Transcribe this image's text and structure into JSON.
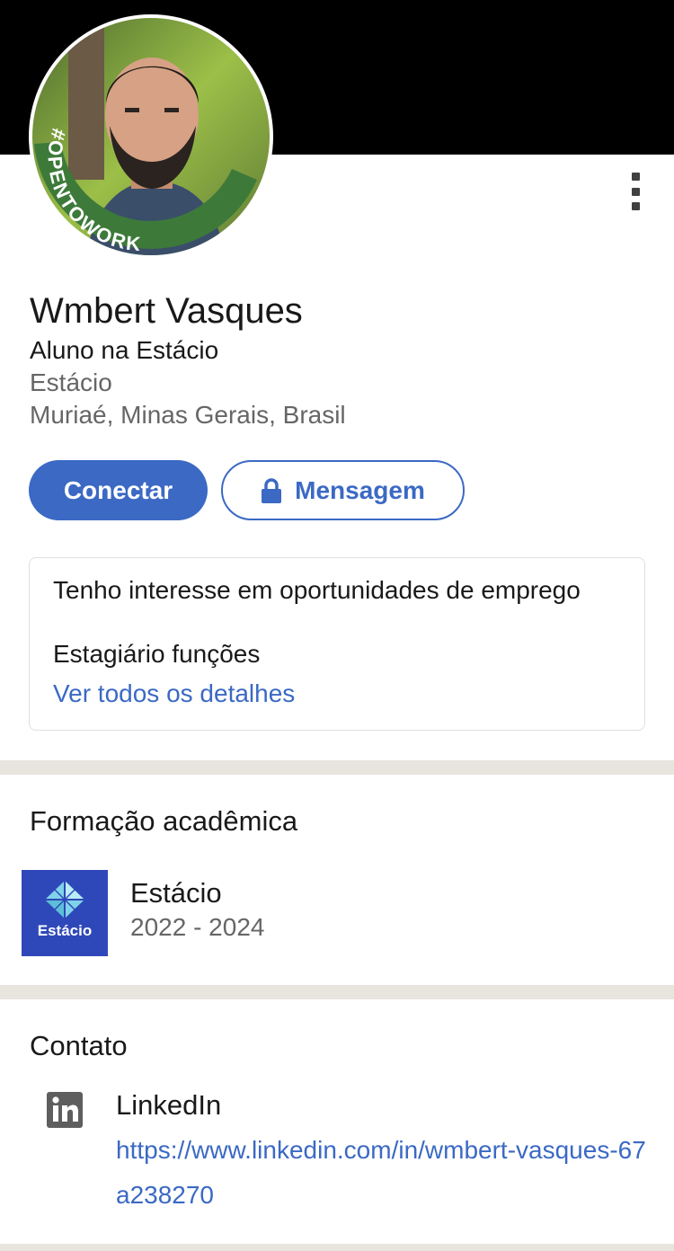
{
  "profile": {
    "name": "Wmbert Vasques",
    "headline": "Aluno na Estácio",
    "company": "Estácio",
    "location": "Muriaé, Minas Gerais, Brasil",
    "badge_text": "#OPENTOWORK"
  },
  "actions": {
    "connect_label": "Conectar",
    "message_label": "Mensagem",
    "more_icon": "vertical-dots-icon",
    "lock_icon": "lock-icon"
  },
  "open_to_work": {
    "title": "Tenho interesse em oportunidades de emprego",
    "roles": "Estagiário funções",
    "link_label": "Ver todos os detalhes"
  },
  "education": {
    "section_title": "Formação acadêmica",
    "items": [
      {
        "school": "Estácio",
        "years": "2022 - 2024",
        "logo_text": "Estácio"
      }
    ]
  },
  "contact": {
    "section_title": "Contato",
    "items": [
      {
        "label": "LinkedIn",
        "url": "https://www.linkedin.com/in/wmbert-vasques-67a238270",
        "icon": "linkedin-icon"
      }
    ]
  },
  "colors": {
    "brand_blue": "#3b69c4",
    "opentowork_green": "#3d7a3a",
    "cover": "#000000",
    "divider": "#e8e5de",
    "estacio_blue": "#2f48b9"
  }
}
